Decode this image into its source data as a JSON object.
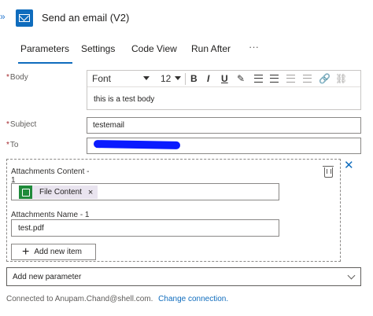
{
  "header": {
    "title": "Send an email (V2)",
    "icon": "outlook-icon",
    "accent": "#0f6cbd"
  },
  "tabs": [
    {
      "label": "Parameters",
      "active": true
    },
    {
      "label": "Settings",
      "active": false
    },
    {
      "label": "Code View",
      "active": false
    },
    {
      "label": "Run After",
      "active": false
    }
  ],
  "tabs_more": "···",
  "fields": {
    "body": {
      "label": "Body",
      "required": "*",
      "font": "Font",
      "font_size": "12",
      "toolbar": {
        "bold": "B",
        "italic": "I",
        "underline": "U"
      },
      "value": "this is a test body"
    },
    "subject": {
      "label": "Subject",
      "required": "*",
      "value": "testemail"
    },
    "to": {
      "label": "To",
      "required": "*",
      "value": ""
    }
  },
  "attachments": {
    "content_label": "Attachments Content -\n1",
    "content_token": {
      "label": "File Content",
      "remove": "×"
    },
    "name_label": "Attachments Name - 1",
    "name_value": "test.pdf",
    "add_item_label": "Add new item",
    "close": "✕"
  },
  "add_parameter": {
    "placeholder": "Add new parameter"
  },
  "footer": {
    "connection_text": "Connected to Anupam.Chand@shell.com.",
    "change_link": "Change connection."
  }
}
